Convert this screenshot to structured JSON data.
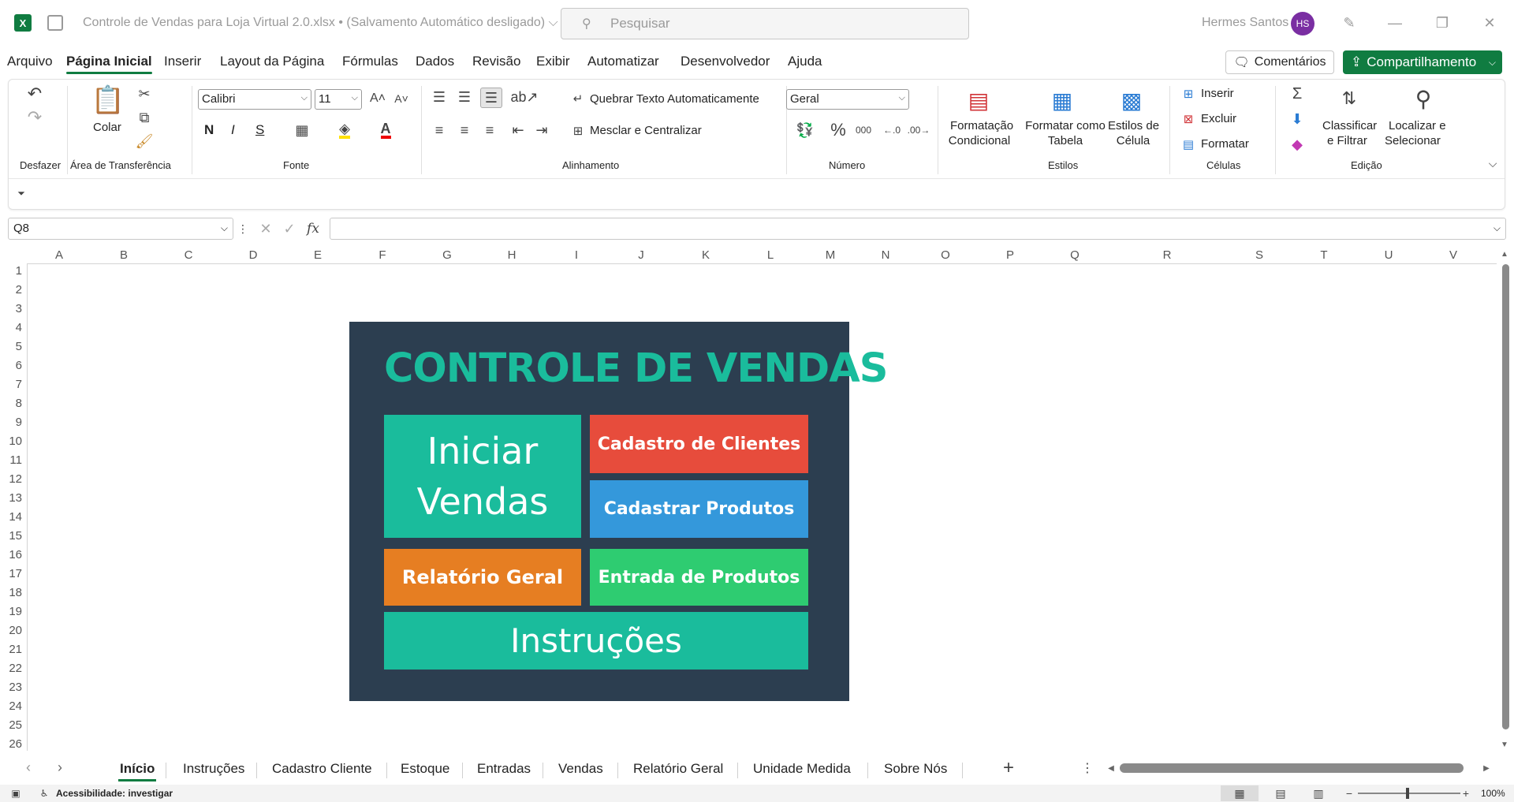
{
  "window": {
    "app_icon": "X",
    "title": "Controle de Vendas para Loja Virtual 2.0.xlsx  •  (Salvamento Automático desligado) ⌵",
    "search_placeholder": "Pesquisar",
    "user_name": "Hermes Santos",
    "user_initials": "HS"
  },
  "menu": {
    "tabs": [
      "Arquivo",
      "Página Inicial",
      "Inserir",
      "Layout da Página",
      "Fórmulas",
      "Dados",
      "Revisão",
      "Exibir",
      "Automatizar",
      "Desenvolvedor",
      "Ajuda"
    ],
    "comments": "Comentários",
    "share": "Compartilhamento"
  },
  "ribbon": {
    "undo_label": "Desfazer",
    "paste_label": "Colar",
    "clipboard_label": "Área de Transferência",
    "font_name": "Calibri",
    "font_size": "11",
    "bold": "N",
    "italic": "I",
    "underline": "S",
    "font_label": "Fonte",
    "wrap_text": "Quebrar Texto Automaticamente",
    "merge_center": "Mesclar e Centralizar",
    "alignment_label": "Alinhamento",
    "number_format": "Geral",
    "number_label": "Número",
    "conditional_formatting": [
      "Formatação",
      "Condicional"
    ],
    "format_as_table": [
      "Formatar como",
      "Tabela"
    ],
    "cell_styles": [
      "Estilos de",
      "Célula"
    ],
    "styles_label": "Estilos",
    "insert": "Inserir",
    "delete": "Excluir",
    "format": "Formatar",
    "cells_label": "Células",
    "sort_filter": [
      "Classificar",
      "e Filtrar"
    ],
    "find_select": [
      "Localizar e",
      "Selecionar"
    ],
    "editing_label": "Edição"
  },
  "formula_bar": {
    "name_box": "Q8",
    "fx": "fx",
    "value": ""
  },
  "grid": {
    "columns": [
      "A",
      "B",
      "C",
      "D",
      "E",
      "F",
      "G",
      "H",
      "I",
      "J",
      "K",
      "L",
      "M",
      "N",
      "O",
      "P",
      "Q",
      "R",
      "S",
      "T",
      "U",
      "V"
    ],
    "rows": [
      "1",
      "2",
      "3",
      "4",
      "5",
      "6",
      "7",
      "8",
      "9",
      "10",
      "11",
      "12",
      "13",
      "14",
      "15",
      "16",
      "17",
      "18",
      "19",
      "20",
      "21",
      "22",
      "23",
      "24",
      "25",
      "26"
    ]
  },
  "dashboard": {
    "title": "CONTROLE DE VENDAS",
    "iniciar_line1": "Iniciar",
    "iniciar_line2": "Vendas",
    "cadastro_clientes": "Cadastro de Clientes",
    "cadastrar_produtos": "Cadastrar Produtos",
    "relatorio_geral": "Relatório Geral",
    "entrada_produtos": "Entrada de Produtos",
    "instrucoes": "Instruções",
    "colors": {
      "panel": "#2c3e50",
      "teal": "#1abc9c",
      "red": "#e74c3c",
      "blue": "#3498db",
      "orange": "#e67e22",
      "green": "#2ecc71"
    }
  },
  "sheet_tabs": [
    "Início",
    "Instruções",
    "Cadastro Cliente",
    "Estoque",
    "Entradas",
    "Vendas",
    "Relatório Geral",
    "Unidade Medida",
    "Sobre Nós"
  ],
  "status": {
    "accessibility": "Acessibilidade: investigar",
    "zoom": "100%"
  }
}
